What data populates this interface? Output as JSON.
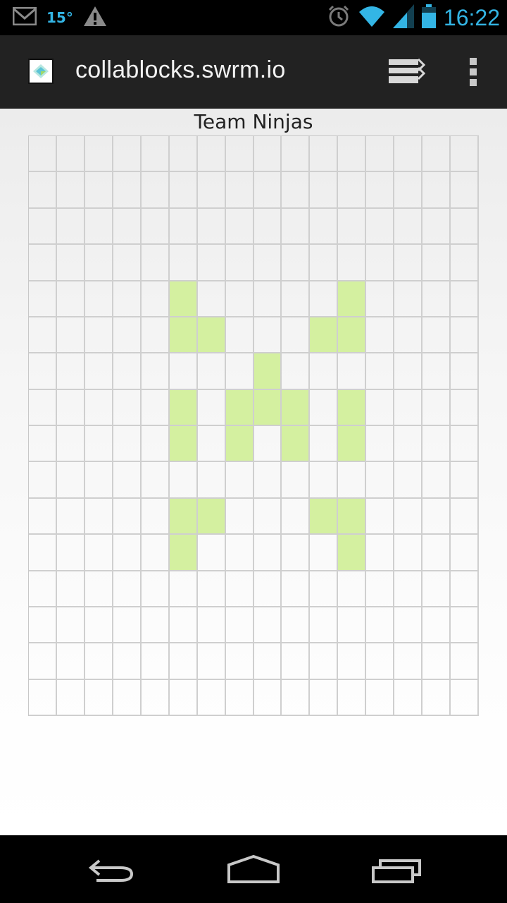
{
  "status_bar": {
    "temperature": "15°",
    "time": "16:22",
    "icons": [
      "gmail-icon",
      "warning-icon",
      "alarm-icon",
      "wifi-icon",
      "signal-icon",
      "battery-icon"
    ],
    "accent_color": "#33b5e5"
  },
  "browser": {
    "url": "collablocks.swrm.io",
    "icons": [
      "site-favicon",
      "tabs-icon",
      "overflow-menu-icon"
    ]
  },
  "page": {
    "title": "Team Ninjas"
  },
  "grid": {
    "rows": 16,
    "cols": 16,
    "filled_color": "#d4f0a0",
    "filled_cells": [
      [
        4,
        5
      ],
      [
        4,
        11
      ],
      [
        5,
        5
      ],
      [
        5,
        6
      ],
      [
        5,
        10
      ],
      [
        5,
        11
      ],
      [
        6,
        8
      ],
      [
        7,
        5
      ],
      [
        7,
        7
      ],
      [
        7,
        8
      ],
      [
        7,
        9
      ],
      [
        7,
        11
      ],
      [
        8,
        5
      ],
      [
        8,
        7
      ],
      [
        8,
        9
      ],
      [
        8,
        11
      ],
      [
        10,
        5
      ],
      [
        10,
        6
      ],
      [
        10,
        10
      ],
      [
        10,
        11
      ],
      [
        11,
        5
      ],
      [
        11,
        11
      ]
    ]
  },
  "nav_bar": {
    "icons": [
      "back-icon",
      "home-icon",
      "recent-apps-icon"
    ]
  }
}
